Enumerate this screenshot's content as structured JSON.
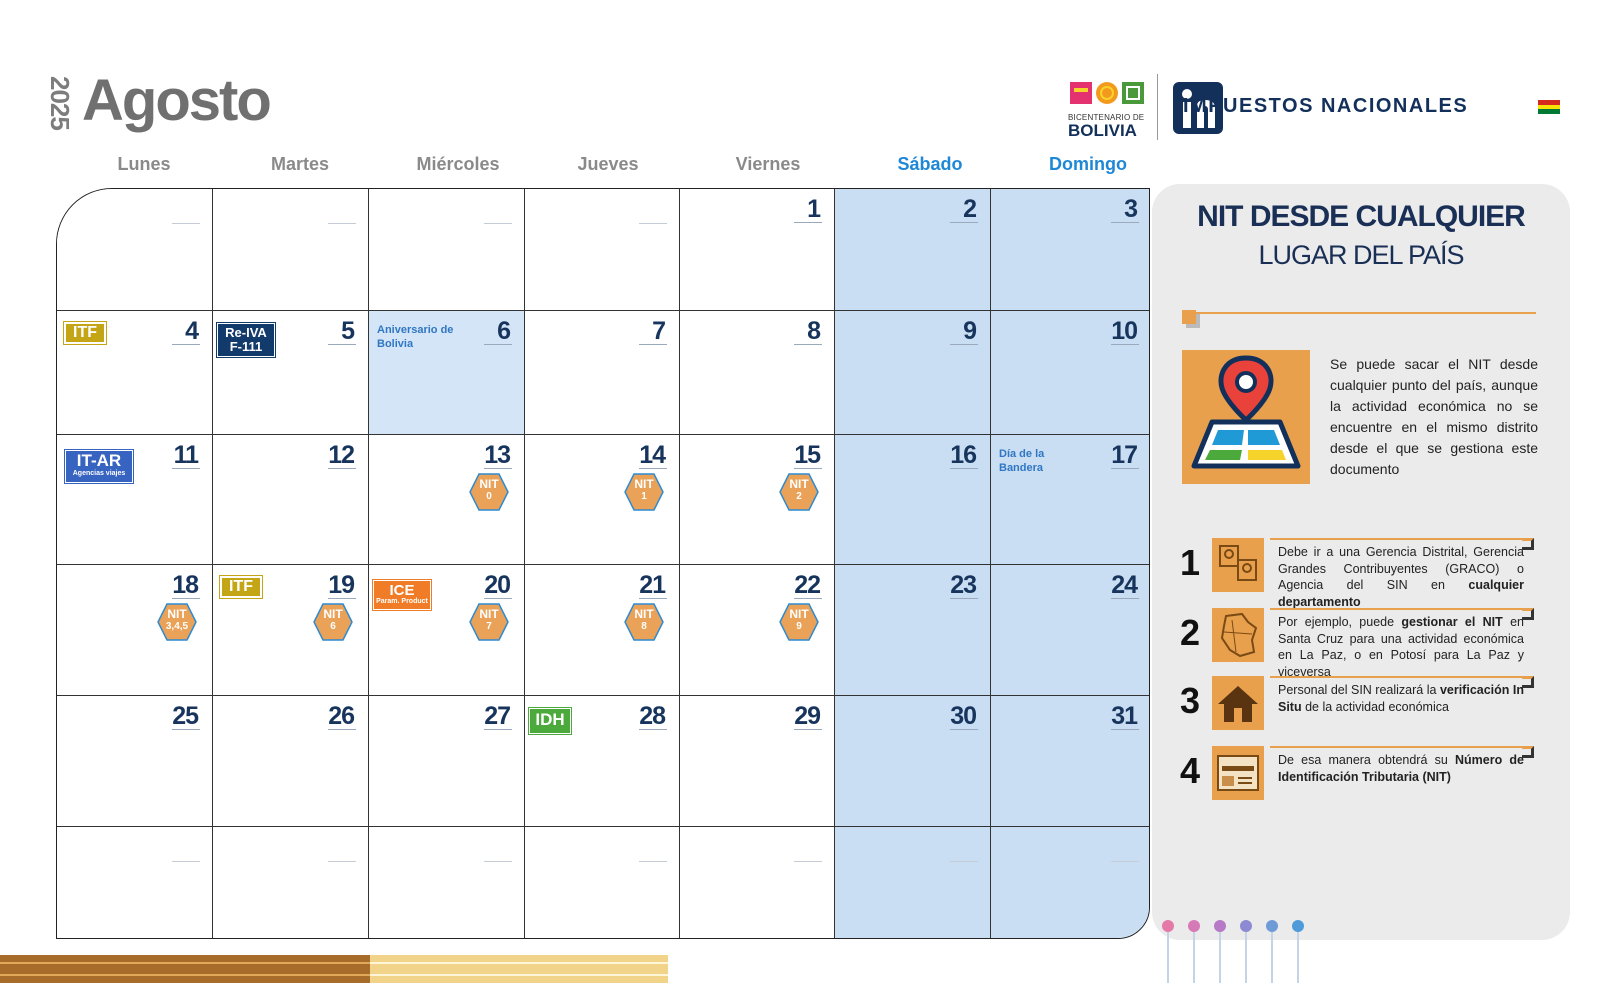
{
  "header": {
    "year": "2025",
    "month": "Agosto",
    "bicentenario_small": "BICENTENARIO DE",
    "bicentenario_big": "BOLIVIA",
    "impuestos": "IMPUESTOS NACIONALES"
  },
  "weekdays": [
    "Lunes",
    "Martes",
    "Miércoles",
    "Jueves",
    "Viernes",
    "Sábado",
    "Domingo"
  ],
  "weeks": [
    [
      "",
      "",
      "",
      "",
      "1",
      "2",
      "3"
    ],
    [
      "4",
      "5",
      "6",
      "7",
      "8",
      "9",
      "10"
    ],
    [
      "11",
      "12",
      "13",
      "14",
      "15",
      "16",
      "17"
    ],
    [
      "18",
      "19",
      "20",
      "21",
      "22",
      "23",
      "24"
    ],
    [
      "25",
      "26",
      "27",
      "28",
      "29",
      "30",
      "31"
    ],
    [
      "",
      "",
      "",
      "",
      "",
      "",
      ""
    ]
  ],
  "holidays": {
    "d6": "Aniversario de Bolivia",
    "d17": "Día de la Bandera"
  },
  "badges": {
    "itf": "ITF",
    "reiva_1": "Re-IVA",
    "reiva_2": "F-111",
    "itar": "IT-AR",
    "itar_sub": "Agencias viajes",
    "ice": "ICE",
    "ice_sub": "Param. Product",
    "idh": "IDH",
    "nit": "NIT"
  },
  "nit_digits": {
    "d13": "0",
    "d14": "1",
    "d15": "2",
    "d18": "3,4,5",
    "d19": "6",
    "d20": "7",
    "d21": "8",
    "d22": "9"
  },
  "panel": {
    "title": "NIT DESDE CUALQUIER",
    "subtitle": "LUGAR DEL PAÍS",
    "description": "Se puede sacar el NIT desde cualquier punto del país, aunque la actividad económica no se encuentre en el mismo distrito desde el que se gestiona este documento",
    "steps": [
      {
        "num": "1",
        "pre": "Debe ir a una Gerencia Distrital, Gerencia Grandes Contribuyentes (GRACO) o Agencia del SIN en ",
        "bold": "cualquier departamento",
        "post": ""
      },
      {
        "num": "2",
        "pre": "Por ejemplo, puede ",
        "bold": "gestionar el NIT",
        "post": " en Santa Cruz para una actividad económica en La Paz, o en Potosí para La Paz y viceversa"
      },
      {
        "num": "3",
        "pre": "Personal del SIN realizará la ",
        "bold": "verificación In Situ",
        "post": " de la actividad económica"
      },
      {
        "num": "4",
        "pre": "De esa manera obtendrá su ",
        "bold": "Número de Identificación Tributaria (NIT)",
        "post": ""
      }
    ]
  },
  "colors": {
    "navy": "#17345c",
    "weekend": "#c9ddf3",
    "accent_orange": "#e8a04d",
    "itf": "#c4a516",
    "reiva": "#123b6b",
    "itar": "#3763c1",
    "ice": "#f07c28",
    "idh": "#4caa3d",
    "nit_hex": "#e9a258"
  }
}
